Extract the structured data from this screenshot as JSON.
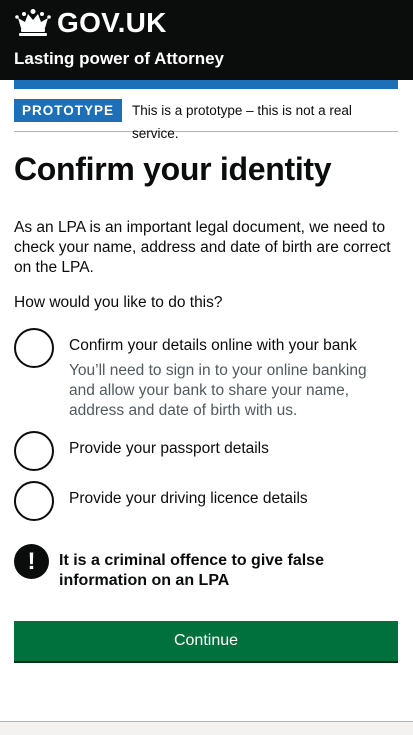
{
  "header": {
    "logo_text": "GOV.UK",
    "service_name": "Lasting power of Attorney"
  },
  "phase_banner": {
    "tag": "PROTOTYPE",
    "text": "This is a prototype – this is not a real service."
  },
  "page": {
    "title": "Confirm your identity",
    "intro": "As an LPA is an important legal document, we need to check your name, address and date of birth are correct on the LPA.",
    "question": "How would you like to do this?"
  },
  "options": [
    {
      "label": "Confirm your details online with your bank",
      "hint": "You’ll need to sign in to your online banking and allow your bank to share your name, address and date of birth with us.",
      "selected": false
    },
    {
      "label": "Provide your passport details",
      "selected": false
    },
    {
      "label": "Provide your driving licence details",
      "selected": false
    }
  ],
  "warning": {
    "icon": "!",
    "text": "It is a criminal offence to give false information on an LPA"
  },
  "continue_button": "Continue",
  "colors": {
    "header_bg": "#0b0c0c",
    "brand_blue": "#1d70b8",
    "button_green": "#00703c",
    "hint_grey": "#505a5f"
  }
}
